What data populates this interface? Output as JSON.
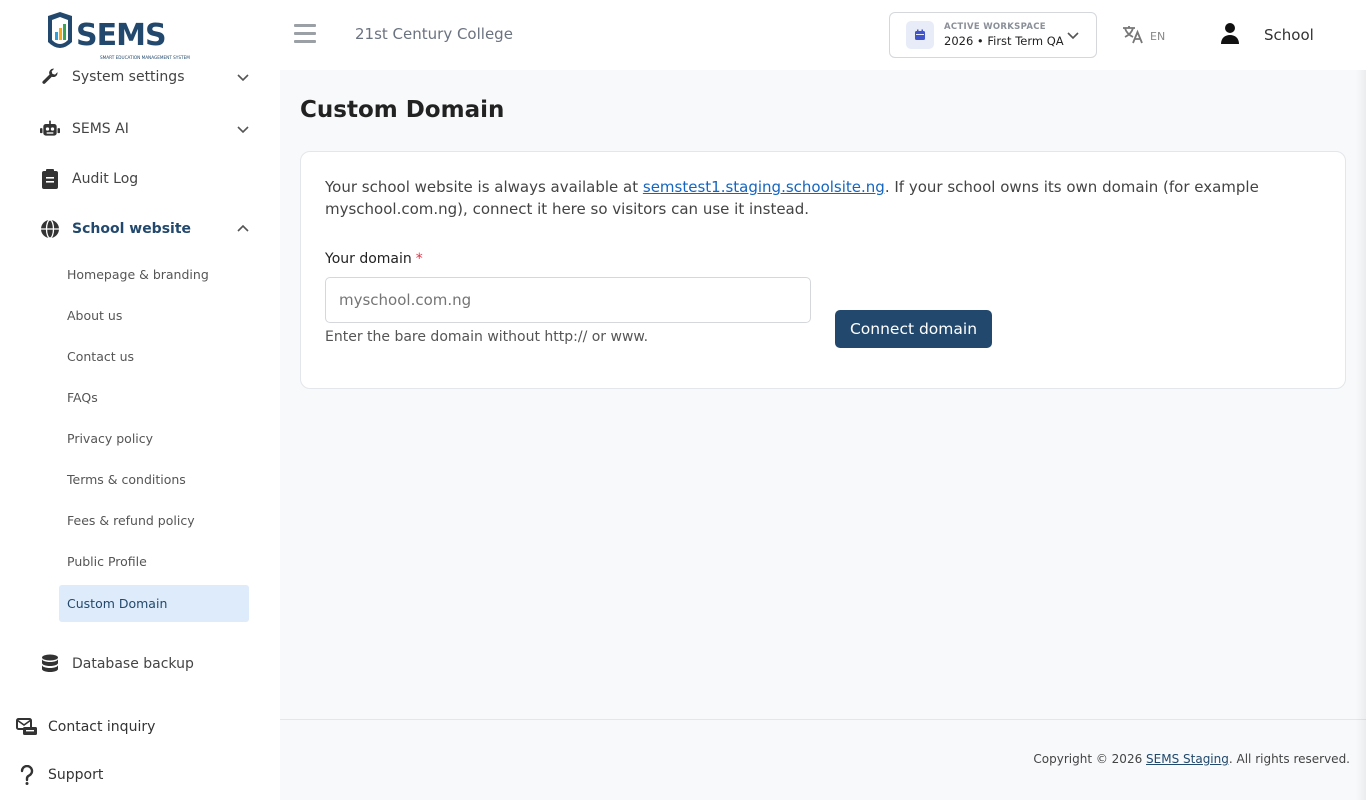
{
  "sidebar": {
    "logo_text": "SEMS",
    "logo_tagline": "SMART EDUCATION MANAGEMENT SYSTEM",
    "items": [
      {
        "label": "System settings",
        "icon": "wrench-icon"
      },
      {
        "label": "SEMS AI",
        "icon": "robot-icon"
      },
      {
        "label": "Audit Log",
        "icon": "clipboard-icon"
      },
      {
        "label": "School website",
        "icon": "globe-icon"
      },
      {
        "label": "Database backup",
        "icon": "database-icon"
      }
    ],
    "sub_items": [
      "Homepage & branding",
      "About us",
      "Contact us",
      "FAQs",
      "Privacy policy",
      "Terms & conditions",
      "Fees & refund policy",
      "Public Profile",
      "Custom Domain"
    ],
    "bottom_items": [
      {
        "label": "Contact inquiry",
        "icon": "inbox-icon"
      },
      {
        "label": "Support",
        "icon": "question-icon"
      }
    ]
  },
  "header": {
    "college_name": "21st Century College",
    "workspace_label": "ACTIVE WORKSPACE",
    "workspace_value": "2026 • First Term QA",
    "language": "EN",
    "user_name": "School"
  },
  "main": {
    "title": "Custom Domain",
    "intro_before": "Your school website is always available at ",
    "intro_link": "semstest1.staging.schoolsite.ng",
    "intro_after": ". If your school owns its own domain (for example myschool.com.ng), connect it here so visitors can use it instead.",
    "field_label": "Your domain",
    "required_mark": "*",
    "input_placeholder": "myschool.com.ng",
    "input_value": "",
    "help_text": "Enter the bare domain without http:// or www.",
    "button_label": "Connect domain"
  },
  "footer": {
    "prefix": "Copyright © 2026 ",
    "link": "SEMS Staging",
    "suffix": ". All rights reserved."
  },
  "colors": {
    "primary": "#22496d",
    "link": "#1565c0",
    "active_bg": "#deebfa",
    "required": "#dc3545"
  }
}
